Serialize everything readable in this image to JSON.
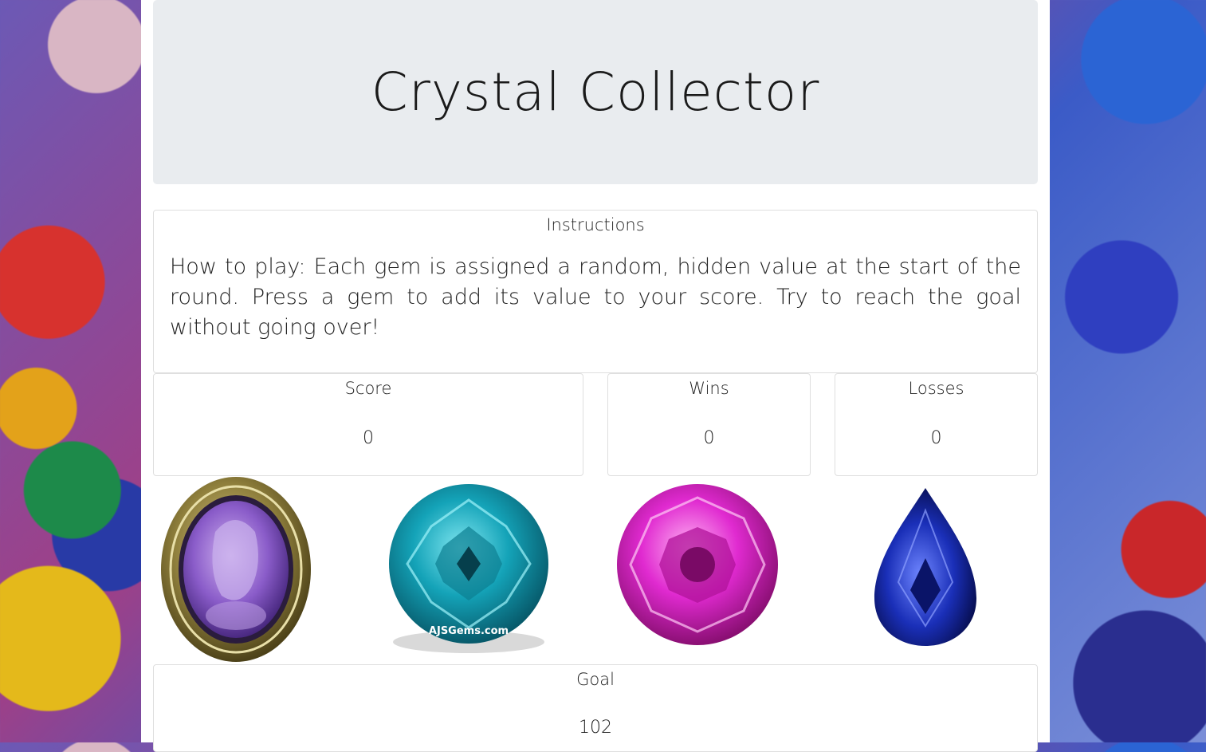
{
  "header": {
    "title": "Crystal Collector"
  },
  "instructions": {
    "heading": "Instructions",
    "text": "How to play: Each gem is assigned a random, hidden value at the start of the round. Press a gem to add its value to your score. Try to reach the goal without going over!"
  },
  "stats": {
    "score": {
      "label": "Score",
      "value": "0"
    },
    "wins": {
      "label": "Wins",
      "value": "0"
    },
    "losses": {
      "label": "Losses",
      "value": "0"
    }
  },
  "gems": [
    {
      "name": "amethyst-intaglio",
      "color": "#8a5cc9",
      "watermark": ""
    },
    {
      "name": "teal-round-gem",
      "color": "#14a3b8",
      "watermark": "AJSGems.com"
    },
    {
      "name": "pink-round-gem",
      "color": "#e02ad0",
      "watermark": ""
    },
    {
      "name": "blue-pear-gem",
      "color": "#1a2fb8",
      "watermark": ""
    }
  ],
  "goal": {
    "label": "Goal",
    "value": "102"
  },
  "colors": {
    "jumbotron": "#e9ecef",
    "card_border": "#dfdfdf"
  }
}
